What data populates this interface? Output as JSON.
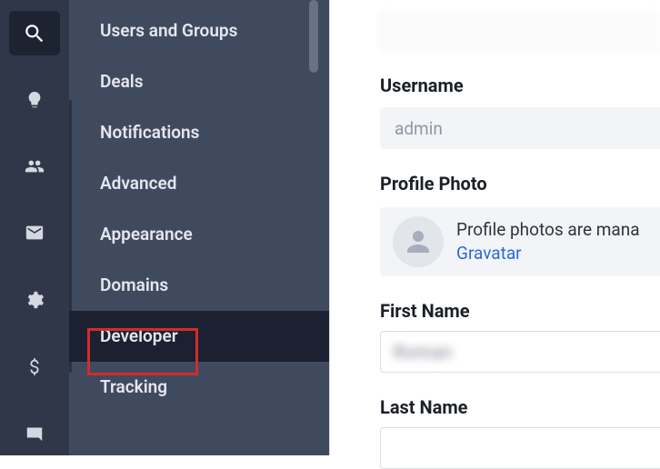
{
  "iconbar": {
    "items": [
      {
        "name": "search-icon"
      },
      {
        "name": "lightbulb-icon"
      },
      {
        "name": "people-icon"
      },
      {
        "name": "mail-icon"
      },
      {
        "name": "gear-sync-icon"
      },
      {
        "name": "dollar-icon"
      },
      {
        "name": "chat-icon"
      }
    ]
  },
  "sidebar": {
    "items": [
      {
        "label": "Users and Groups"
      },
      {
        "label": "Deals"
      },
      {
        "label": "Notifications"
      },
      {
        "label": "Advanced"
      },
      {
        "label": "Appearance"
      },
      {
        "label": "Domains"
      },
      {
        "label": "Developer"
      },
      {
        "label": "Tracking"
      }
    ],
    "active_index": 6
  },
  "form": {
    "username_label": "Username",
    "username_value": "admin",
    "profile_photo_label": "Profile Photo",
    "profile_photo_text": "Profile photos are mana",
    "profile_photo_link": "Gravatar",
    "first_name_label": "First Name",
    "first_name_value": "Roman",
    "last_name_label": "Last Name"
  },
  "colors": {
    "iconbar_bg": "#2f3748",
    "sidebar_bg": "#404a5f",
    "active_bg": "#1b2130",
    "highlight": "#d42b2b",
    "link": "#2a6bd4"
  }
}
